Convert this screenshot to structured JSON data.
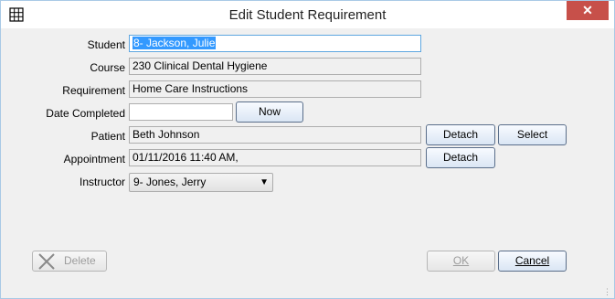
{
  "window": {
    "title": "Edit Student Requirement",
    "close_glyph": "✕"
  },
  "labels": {
    "student": "Student",
    "course": "Course",
    "requirement": "Requirement",
    "date_completed": "Date Completed",
    "patient": "Patient",
    "appointment": "Appointment",
    "instructor": "Instructor"
  },
  "fields": {
    "student": "8- Jackson, Julie",
    "course": "230 Clinical Dental Hygiene",
    "requirement": "Home Care Instructions",
    "date_completed": "",
    "patient": "Beth Johnson",
    "appointment": "01/11/2016 11:40 AM,",
    "instructor_selected": "9- Jones, Jerry"
  },
  "buttons": {
    "now": "Now",
    "patient_detach": "Detach",
    "patient_select": "Select",
    "appointment_detach": "Detach",
    "delete": "Delete",
    "ok": "OK",
    "cancel": "Cancel"
  },
  "colors": {
    "selection": "#3399ff",
    "close": "#c7504a",
    "delete_icon": "#8a8a8a"
  }
}
